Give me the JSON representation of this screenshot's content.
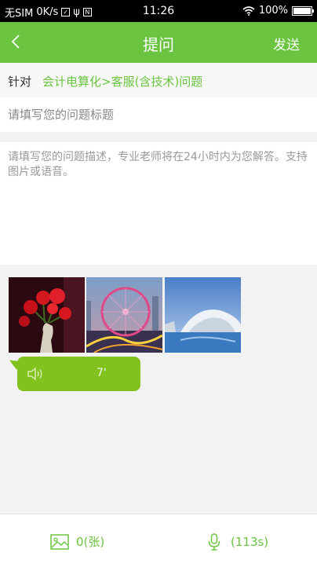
{
  "status_bar": {
    "carrier": "无SIM",
    "speed": "0K/s",
    "time": "11:26",
    "battery": "100%"
  },
  "header": {
    "title": "提问",
    "send_label": "发送",
    "back_glyph": "‹"
  },
  "target": {
    "label": "针对",
    "value": "会计电算化>客服(含技术)问题"
  },
  "question_title": {
    "placeholder": "请填写您的问题标题",
    "value": ""
  },
  "question_description": {
    "placeholder": "请填写您的问题描述，专业老师将在24小时内为您解答。支持图片或语音。",
    "value": ""
  },
  "attachments": {
    "images": [
      {
        "name": "red-flowers-photo"
      },
      {
        "name": "ferris-wheel-photo"
      },
      {
        "name": "architecture-photo"
      }
    ],
    "voice": {
      "duration": "7'",
      "icon": "speaker-icon"
    }
  },
  "bottom_bar": {
    "image_count": "0(张)",
    "voice_seconds": "(113s)",
    "image_icon": "image-icon",
    "mic_icon": "microphone-icon"
  },
  "colors": {
    "brand_green": "#6ac43f",
    "bubble_green": "#82c21f",
    "background": "#f2f2f2"
  }
}
